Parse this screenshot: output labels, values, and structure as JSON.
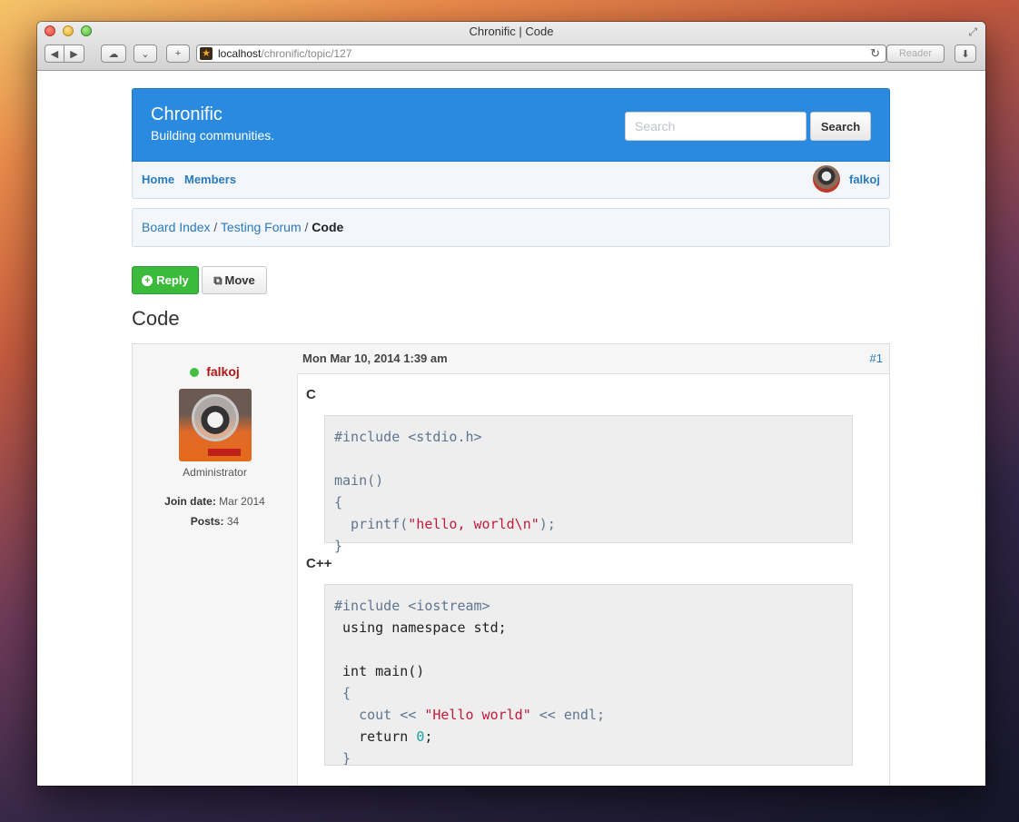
{
  "browser": {
    "window_title": "Chronific | Code",
    "url_host": "localhost",
    "url_path": "/chronific/topic/127",
    "reader_label": "Reader"
  },
  "site": {
    "brand": "Chronific",
    "tagline": "Building communities.",
    "search_placeholder": "Search",
    "search_button": "Search"
  },
  "nav": {
    "home": "Home",
    "members": "Members",
    "user": "falkoj"
  },
  "breadcrumb": {
    "items": [
      "Board Index",
      "Testing Forum"
    ],
    "separator": "/",
    "active": "Code"
  },
  "actions": {
    "reply": "Reply",
    "move": "Move"
  },
  "topic": {
    "title": "Code"
  },
  "post": {
    "author": "falkoj",
    "role": "Administrator",
    "join_label": "Join date:",
    "join_value": "Mar 2014",
    "posts_label": "Posts:",
    "posts_value": "34",
    "date": "Mon Mar 10, 2014 1:39 am",
    "number": "#1",
    "sections": [
      {
        "language": "C",
        "code_lines": [
          "#include <stdio.h>",
          "",
          "main()",
          "{",
          "  printf(\"hello, world\\n\");",
          "}"
        ]
      },
      {
        "language": "C++",
        "code_lines": [
          "#include <iostream>",
          " using namespace std;",
          "",
          " int main()",
          " {",
          "   cout << \"Hello world\" << endl;",
          "   return 0;",
          " }"
        ]
      }
    ]
  },
  "colors": {
    "header_blue": "#2a8ae0",
    "link_blue": "#2a7ac0",
    "reply_green": "#3cba3c",
    "author_red": "#b01818",
    "online_green": "#44c040"
  }
}
